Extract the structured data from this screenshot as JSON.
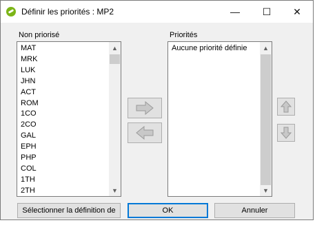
{
  "window": {
    "title": "Définir les priorités : MP2"
  },
  "titlebar": {
    "minimize_glyph": "—",
    "maximize_glyph": "☐",
    "close_glyph": "✕"
  },
  "left": {
    "label": "Non priorisé",
    "items": [
      "MAT",
      "MRK",
      "LUK",
      "JHN",
      "ACT",
      "ROM",
      "1CO",
      "2CO",
      "GAL",
      "EPH",
      "PHP",
      "COL",
      "1TH",
      "2TH"
    ]
  },
  "right": {
    "label": "Priorités",
    "items": [
      "Aucune priorité définie"
    ]
  },
  "scroll": {
    "up_glyph": "▲",
    "down_glyph": "▼"
  },
  "buttons": {
    "select_definition": "Sélectionner la définition de",
    "ok": "OK",
    "cancel": "Annuler"
  },
  "icons": {
    "move_right": "arrow-right-icon",
    "move_left": "arrow-left-icon",
    "move_up": "arrow-up-icon",
    "move_down": "arrow-down-icon"
  }
}
